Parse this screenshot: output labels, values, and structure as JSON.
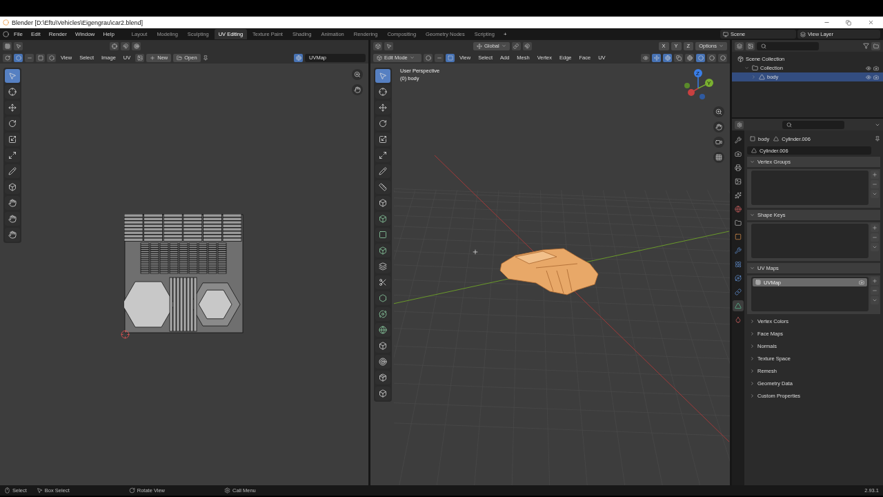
{
  "window": {
    "title": "Blender [D:\\Eftu\\Vehicles\\Eigengrau\\car2.blend]"
  },
  "menu": [
    "File",
    "Edit",
    "Render",
    "Window",
    "Help"
  ],
  "workspaces": [
    {
      "label": "Layout",
      "selected": false
    },
    {
      "label": "Modeling",
      "selected": false
    },
    {
      "label": "Sculpting",
      "selected": false
    },
    {
      "label": "UV Editing",
      "selected": true
    },
    {
      "label": "Texture Paint",
      "selected": false
    },
    {
      "label": "Shading",
      "selected": false
    },
    {
      "label": "Animation",
      "selected": false
    },
    {
      "label": "Rendering",
      "selected": false
    },
    {
      "label": "Compositing",
      "selected": false
    },
    {
      "label": "Geometry Nodes",
      "selected": false
    },
    {
      "label": "Scripting",
      "selected": false
    }
  ],
  "add_workspace": "+",
  "scene": "Scene",
  "view_layer": "View Layer",
  "uv_editor": {
    "menus": [
      "View",
      "Select",
      "Image",
      "UV"
    ],
    "new_button": "New",
    "open_button": "Open",
    "uv_map": "UVMap",
    "select_modes": [
      {
        "kind": "vertex",
        "selected": true
      },
      {
        "kind": "edge",
        "selected": false
      },
      {
        "kind": "face",
        "selected": false
      },
      {
        "kind": "island",
        "selected": false
      }
    ],
    "tools": [
      {
        "kind": "select",
        "selected": true
      },
      {
        "kind": "cursor",
        "selected": false
      },
      {
        "kind": "move",
        "selected": false
      },
      {
        "kind": "rotate",
        "selected": false
      },
      {
        "kind": "scale",
        "selected": false
      },
      {
        "kind": "transform",
        "selected": false
      },
      {
        "kind": "annotate",
        "selected": false
      },
      {
        "kind": "rip",
        "selected": false
      },
      {
        "kind": "grab",
        "selected": false
      },
      {
        "kind": "relax",
        "selected": false
      },
      {
        "kind": "pinch",
        "selected": false
      }
    ]
  },
  "viewport": {
    "mode": "Edit Mode",
    "orientation": "Global",
    "options": "Options",
    "mirror_axes": [
      "X",
      "Y",
      "Z"
    ],
    "menus": [
      "View",
      "Select",
      "Add",
      "Mesh",
      "Vertex",
      "Edge",
      "Face",
      "UV"
    ],
    "select_modes": [
      {
        "kind": "vertex",
        "selected": false
      },
      {
        "kind": "edge",
        "selected": false
      },
      {
        "kind": "face",
        "selected": true
      }
    ],
    "overlay_text": [
      "User Perspective",
      "(0) body"
    ],
    "gizmo_axes": [
      "Z",
      "Y"
    ],
    "tools": [
      {
        "kind": "select",
        "selected": true
      },
      {
        "kind": "cursor",
        "selected": false
      },
      {
        "kind": "move",
        "selected": false
      },
      {
        "kind": "rotate",
        "selected": false
      },
      {
        "kind": "scale",
        "selected": false
      },
      {
        "kind": "transform",
        "selected": false
      },
      {
        "kind": "annotate",
        "selected": false
      },
      {
        "kind": "measure",
        "selected": false
      },
      {
        "kind": "add-cube",
        "selected": false
      },
      {
        "kind": "extrude",
        "selected": false
      },
      {
        "kind": "inset",
        "selected": false
      },
      {
        "kind": "bevel",
        "selected": false
      },
      {
        "kind": "loop-cut",
        "selected": false
      },
      {
        "kind": "knife",
        "selected": false
      },
      {
        "kind": "poly-build",
        "selected": false
      },
      {
        "kind": "spin",
        "selected": false
      },
      {
        "kind": "smooth",
        "selected": false
      },
      {
        "kind": "edge-slide",
        "selected": false
      },
      {
        "kind": "shrink",
        "selected": false
      },
      {
        "kind": "shear",
        "selected": false
      },
      {
        "kind": "rip",
        "selected": false
      }
    ]
  },
  "outliner": {
    "items": [
      {
        "kind": "scene",
        "label": "Scene Collection",
        "selected": false,
        "children": [
          {
            "kind": "collection",
            "label": "Collection",
            "selected": false,
            "expanded": true,
            "children": [
              {
                "kind": "mesh",
                "label": "body",
                "selected": true,
                "expanded": false
              }
            ]
          }
        ]
      }
    ]
  },
  "properties": {
    "object": "body",
    "mesh": "Cylinder.006",
    "datablock": "Cylinder.006",
    "tabs": [
      {
        "kind": "tool",
        "selected": false
      },
      {
        "kind": "render",
        "selected": false
      },
      {
        "kind": "output",
        "selected": false
      },
      {
        "kind": "view-layer",
        "selected": false
      },
      {
        "kind": "scene",
        "selected": false
      },
      {
        "kind": "world",
        "selected": false
      },
      {
        "kind": "collection",
        "selected": false
      },
      {
        "kind": "object",
        "selected": false
      },
      {
        "kind": "modifiers",
        "selected": false
      },
      {
        "kind": "particles",
        "selected": false
      },
      {
        "kind": "physics",
        "selected": false
      },
      {
        "kind": "constraints",
        "selected": false
      },
      {
        "kind": "data",
        "selected": true
      },
      {
        "kind": "material",
        "selected": false
      }
    ],
    "panels": [
      {
        "title": "Vertex Groups",
        "expanded": true
      },
      {
        "title": "Shape Keys",
        "expanded": true
      },
      {
        "title": "UV Maps",
        "expanded": true,
        "items": [
          {
            "label": "UVMap",
            "selected": true
          }
        ]
      },
      {
        "title": "Vertex Colors",
        "expanded": false
      },
      {
        "title": "Face Maps",
        "expanded": false
      },
      {
        "title": "Normals",
        "expanded": false
      },
      {
        "title": "Texture Space",
        "expanded": false
      },
      {
        "title": "Remesh",
        "expanded": false
      },
      {
        "title": "Geometry Data",
        "expanded": false
      },
      {
        "title": "Custom Properties",
        "expanded": false
      }
    ]
  },
  "status_bar": {
    "hints": [
      {
        "kind": "left",
        "label": "Select"
      },
      {
        "kind": "drag",
        "label": "Box Select"
      },
      {
        "kind": "middle",
        "label": "Rotate View"
      },
      {
        "kind": "right",
        "label": "Call Menu"
      }
    ],
    "version": "2.93.1"
  }
}
